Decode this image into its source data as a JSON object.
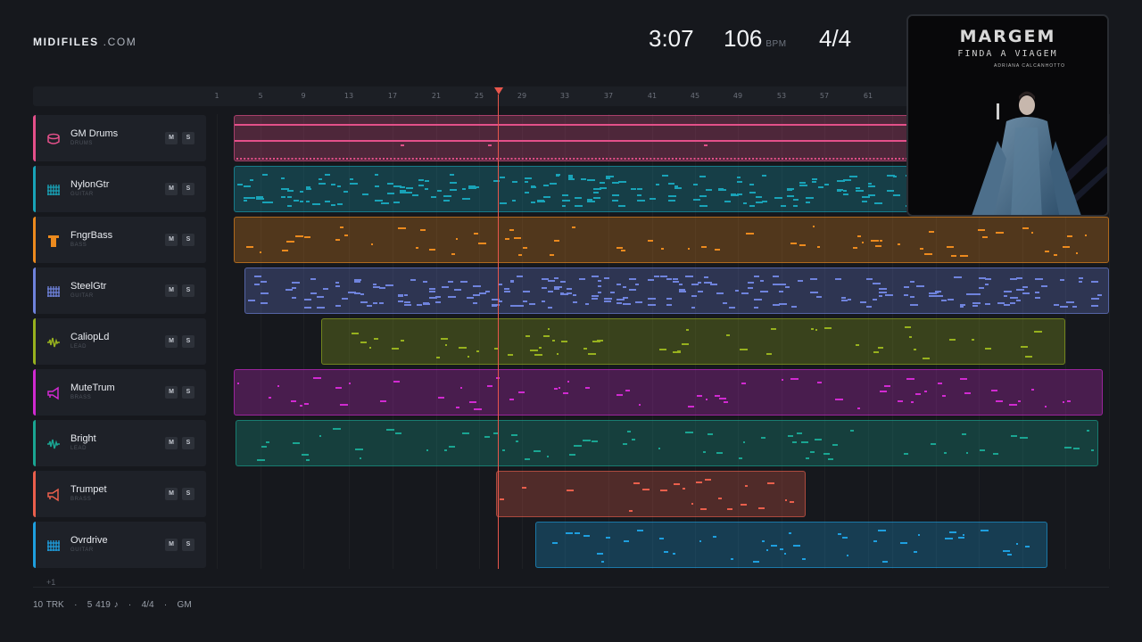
{
  "brand": {
    "bold": "MIDIFILES",
    "light": ".COM"
  },
  "stats": {
    "time": "3:07",
    "tempo": "106",
    "tempo_unit": "BPM",
    "meter": "4/4"
  },
  "ruler": {
    "ticks": [
      "1",
      "5",
      "9",
      "13",
      "17",
      "21",
      "25",
      "29",
      "33",
      "37",
      "41",
      "45",
      "49",
      "53",
      "57",
      "61"
    ]
  },
  "tracks": [
    {
      "name": "GM Drums",
      "category": "DRUMS",
      "color": "#e4508a",
      "icon": "drum-icon",
      "mute": "M",
      "solo": "S"
    },
    {
      "name": "NylonGtr",
      "category": "GUITAR",
      "color": "#19a3b8",
      "icon": "guitar-grid-icon",
      "mute": "M",
      "solo": "S"
    },
    {
      "name": "FngrBass",
      "category": "BASS",
      "color": "#ec8a1e",
      "icon": "bass-icon",
      "mute": "M",
      "solo": "S"
    },
    {
      "name": "SteelGtr",
      "category": "GUITAR",
      "color": "#6f83dd",
      "icon": "guitar-grid-icon",
      "mute": "M",
      "solo": "S"
    },
    {
      "name": "CaliopLd",
      "category": "LEAD",
      "color": "#97b11e",
      "icon": "waveform-icon",
      "mute": "M",
      "solo": "S"
    },
    {
      "name": "MuteTrum",
      "category": "BRASS",
      "color": "#d12ad1",
      "icon": "trumpet-icon",
      "mute": "M",
      "solo": "S"
    },
    {
      "name": "Bright",
      "category": "LEAD",
      "color": "#1aa592",
      "icon": "waveform-icon",
      "mute": "M",
      "solo": "S"
    },
    {
      "name": "Trumpet",
      "category": "BRASS",
      "color": "#ea5f4c",
      "icon": "trumpet-icon",
      "mute": "M",
      "solo": "S"
    },
    {
      "name": "Ovrdrive",
      "category": "GUITAR",
      "color": "#1e9fdf",
      "icon": "guitar-grid-icon",
      "mute": "M",
      "solo": "S"
    }
  ],
  "more_tracks": "+1",
  "footer": {
    "tracks": "10 TRK",
    "notes": "5 419 ♪",
    "meter": "4/4",
    "standard": "GM",
    "sep": "·"
  },
  "album": {
    "title": "MARGEM",
    "subtitle": "FINDA A VIAGEM",
    "artist": "ADRIANA CALCANHOTTO"
  }
}
